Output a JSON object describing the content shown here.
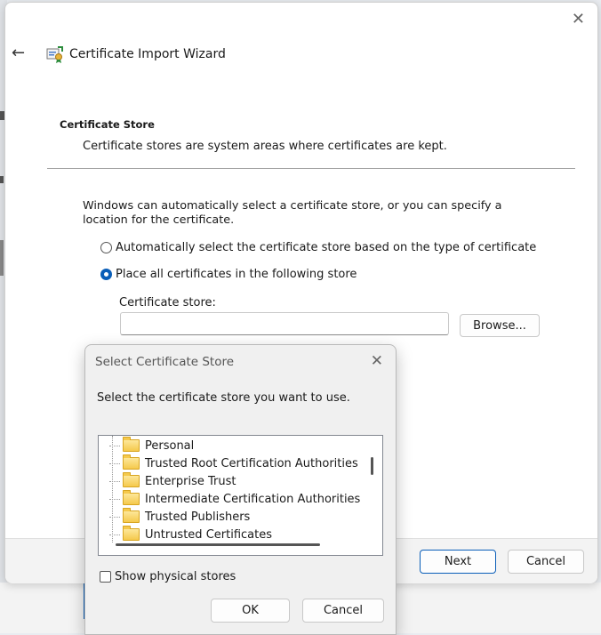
{
  "wizard": {
    "title": "Certificate Import Wizard",
    "close_glyph": "✕",
    "back_glyph": "←",
    "icon": "certificate-icon",
    "section_heading": "Certificate Store",
    "section_description": "Certificate stores are system areas where certificates are kept.",
    "intro": "Windows can automatically select a certificate store, or you can specify a location for the certificate.",
    "radio_auto_label": "Automatically select the certificate store based on the type of certificate",
    "radio_auto_checked": false,
    "radio_manual_label": "Place all certificates in the following store",
    "radio_manual_checked": true,
    "store_label": "Certificate store:",
    "store_value": "",
    "browse_label": "Browse...",
    "next_label": "Next",
    "cancel_label": "Cancel",
    "accent_color": "#0a5eb8"
  },
  "dialog": {
    "title": "Select Certificate Store",
    "close_glyph": "✕",
    "prompt": "Select the certificate store you want to use.",
    "stores": [
      {
        "label": "Personal",
        "icon": "folder-icon"
      },
      {
        "label": "Trusted Root Certification Authorities",
        "icon": "folder-icon"
      },
      {
        "label": "Enterprise Trust",
        "icon": "folder-icon"
      },
      {
        "label": "Intermediate Certification Authorities",
        "icon": "folder-icon"
      },
      {
        "label": "Trusted Publishers",
        "icon": "folder-icon"
      },
      {
        "label": "Untrusted Certificates",
        "icon": "folder-icon"
      }
    ],
    "show_physical_label": "Show physical stores",
    "show_physical_checked": false,
    "ok_label": "OK",
    "cancel_label": "Cancel"
  }
}
